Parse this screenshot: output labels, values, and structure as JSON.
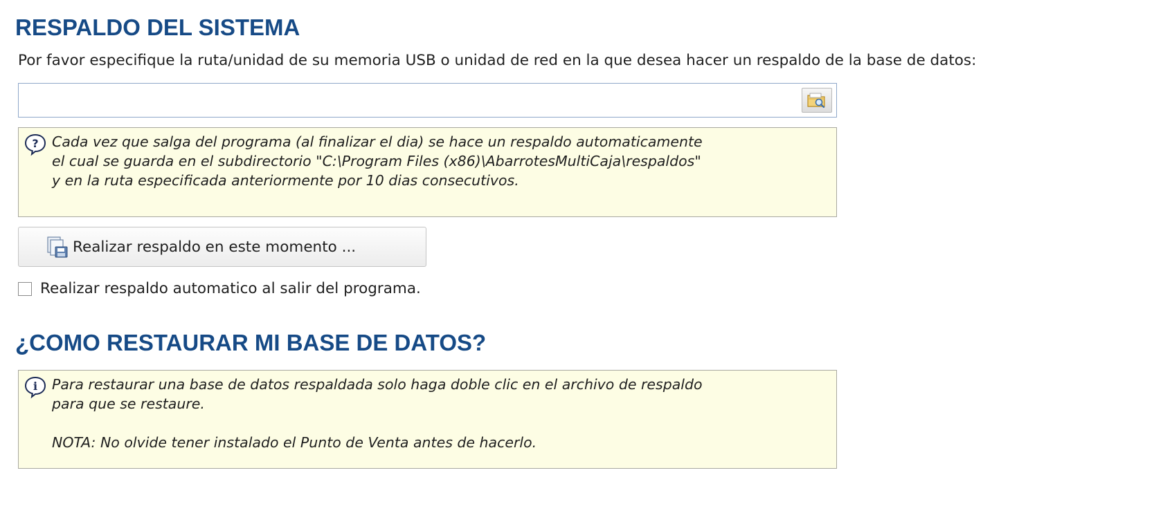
{
  "backup": {
    "title": "RESPALDO DEL SISTEMA",
    "instruction": "Por favor especifique la ruta/unidad de su memoria USB o unidad de red en la que desea hacer un respaldo de la base de datos:",
    "path_value": "",
    "browse_icon": "folder-search-icon",
    "note_icon": "help-question-icon",
    "note_lines": [
      "Cada vez que salga del programa (al finalizar el dia) se hace un respaldo automaticamente",
      "el cual se guarda en el subdirectorio \"C:\\Program Files (x86)\\AbarrotesMultiCaja\\respaldos\"",
      "y en la ruta especificada anteriormente por 10 dias consecutivos."
    ],
    "button_icon": "backup-disk-icon",
    "button_label": "Realizar respaldo en este momento ...",
    "auto_checkbox_label": "Realizar respaldo automatico al salir del programa.",
    "auto_checkbox_checked": false
  },
  "restore": {
    "title": "¿COMO RESTAURAR MI BASE DE DATOS?",
    "note_icon": "info-icon",
    "note_lines": [
      "Para restaurar una base de datos respaldada solo haga doble clic en el archivo de respaldo",
      "para que se restaure."
    ],
    "note_footer": "NOTA: No olvide tener instalado el Punto de Venta antes de hacerlo."
  },
  "colors": {
    "heading": "#164a86",
    "note_background": "#fdfde4",
    "input_border": "#8fa7c9"
  }
}
